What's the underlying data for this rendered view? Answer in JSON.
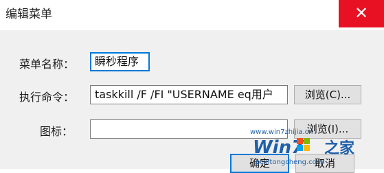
{
  "window": {
    "title": "编辑菜单",
    "close_glyph": "✕"
  },
  "form": {
    "name_label": "菜单名称：",
    "name_value": "瞬秒程序",
    "command_label": "执行命令：",
    "command_value": "taskkill /F /FI \"USERNAME eq用户",
    "browse_command_label": "浏览(C)...",
    "icon_label": "图标：",
    "icon_value": "",
    "browse_icon_label": "浏览(I)..."
  },
  "buttons": {
    "ok_label": "确定",
    "cancel_label": "取消"
  },
  "watermark": {
    "line1": "www.win7zhijia.cn",
    "brand": "Win7",
    "cn": "之家",
    "line2": "pcxitongcheng.com"
  },
  "colors": {
    "close": "#e81123",
    "accent": "#0078d7",
    "watermark": "#1f5fa8"
  }
}
